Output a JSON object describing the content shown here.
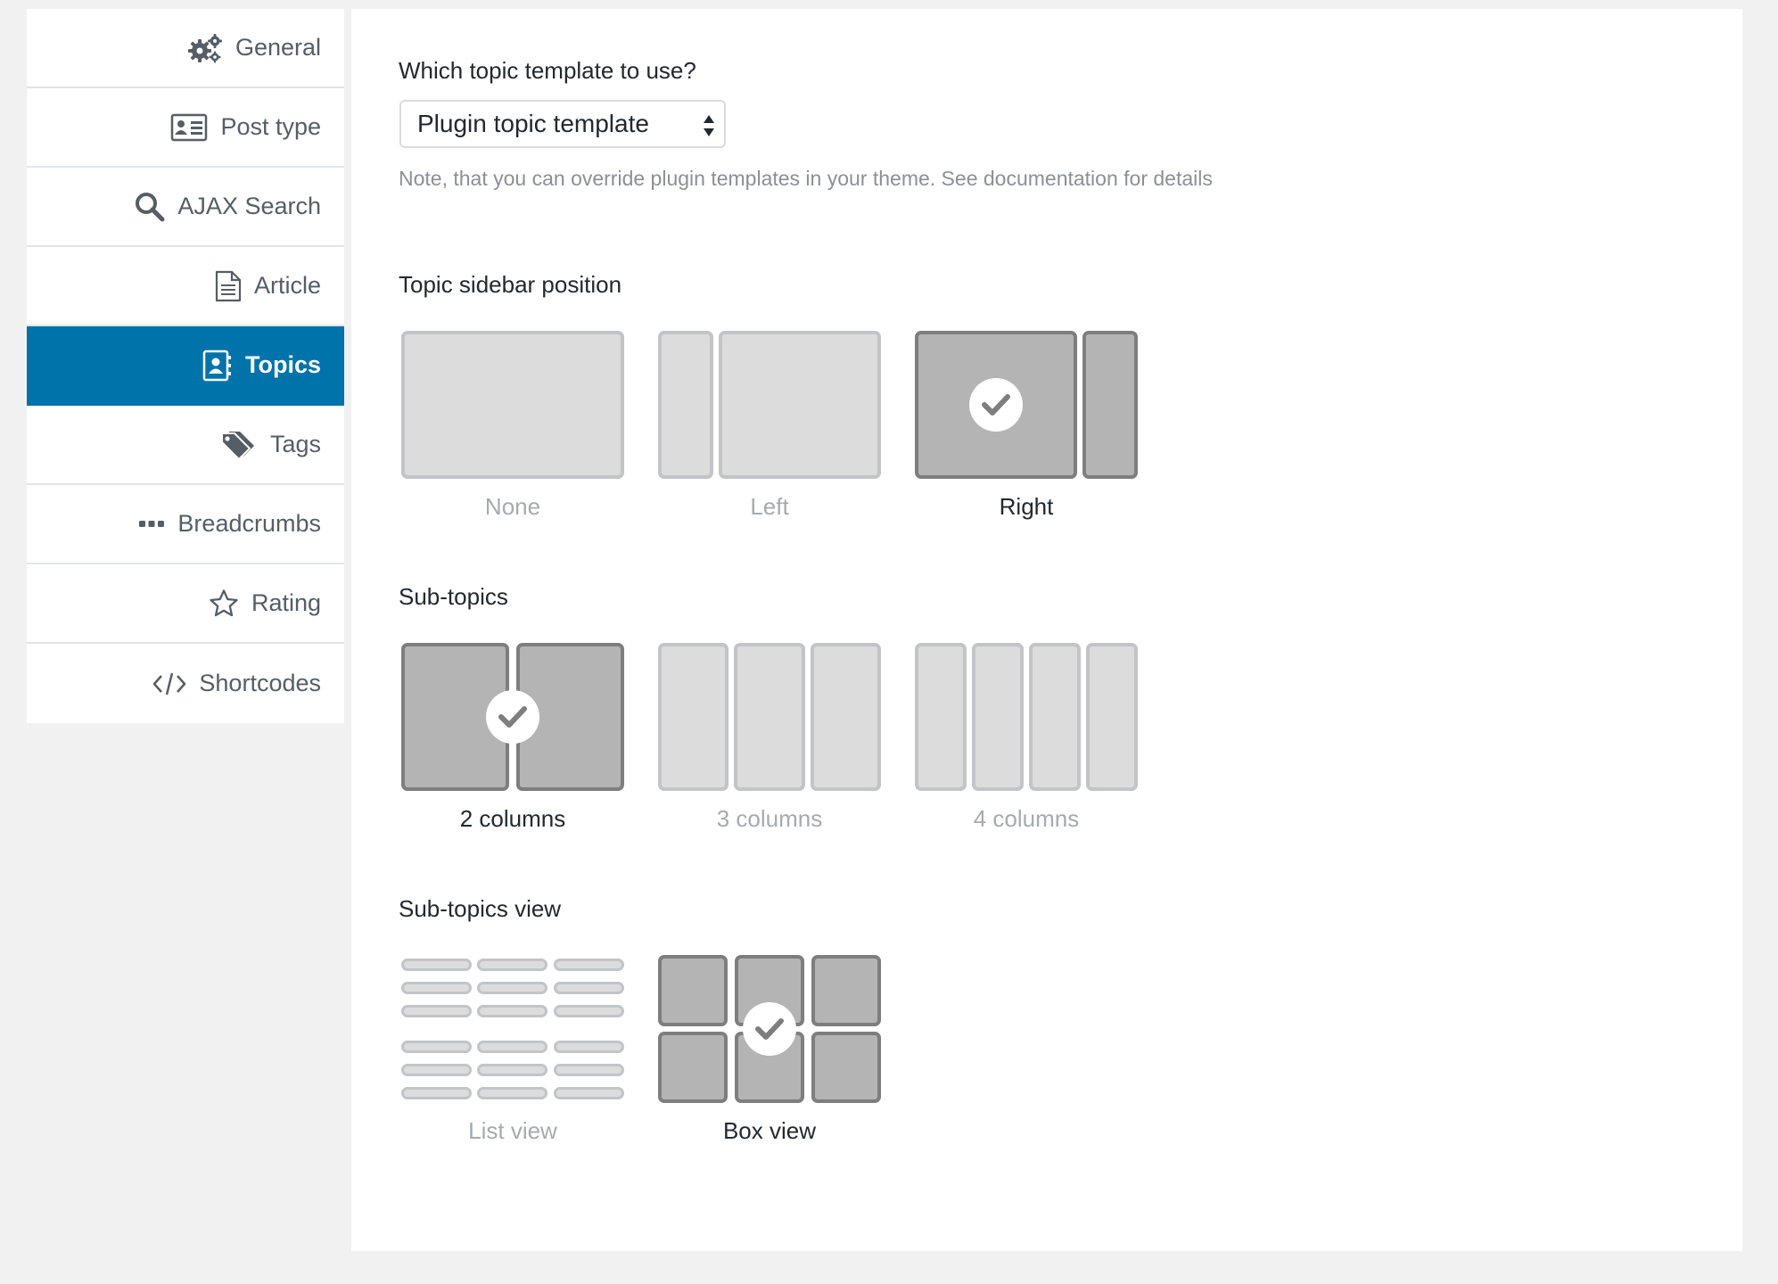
{
  "sidebar": {
    "items": [
      {
        "label": "General",
        "icon": "gears-icon",
        "active": false
      },
      {
        "label": "Post type",
        "icon": "id-card-icon",
        "active": false
      },
      {
        "label": "AJAX Search",
        "icon": "search-icon",
        "active": false
      },
      {
        "label": "Article",
        "icon": "document-icon",
        "active": false
      },
      {
        "label": "Topics",
        "icon": "contact-book-icon",
        "active": true
      },
      {
        "label": "Tags",
        "icon": "tags-icon",
        "active": false
      },
      {
        "label": "Breadcrumbs",
        "icon": "ellipsis-icon",
        "active": false
      },
      {
        "label": "Rating",
        "icon": "star-icon",
        "active": false
      },
      {
        "label": "Shortcodes",
        "icon": "code-icon",
        "active": false
      }
    ]
  },
  "template": {
    "question": "Which topic template to use?",
    "selected": "Plugin topic template",
    "note": "Note, that you can override plugin templates in your theme. See documentation for details"
  },
  "sidebar_position": {
    "title": "Topic sidebar position",
    "options": [
      "None",
      "Left",
      "Right"
    ],
    "selected": "Right"
  },
  "sub_topics": {
    "title": "Sub-topics",
    "options": [
      "2 columns",
      "3 columns",
      "4 columns"
    ],
    "selected": "2 columns"
  },
  "sub_topics_view": {
    "title": "Sub-topics view",
    "options": [
      "List view",
      "Box view"
    ],
    "selected": "Box view"
  },
  "colors": {
    "accent": "#0073aa",
    "selected_fill": "#b4b4b4",
    "unselected_fill": "#dcdcdc"
  }
}
